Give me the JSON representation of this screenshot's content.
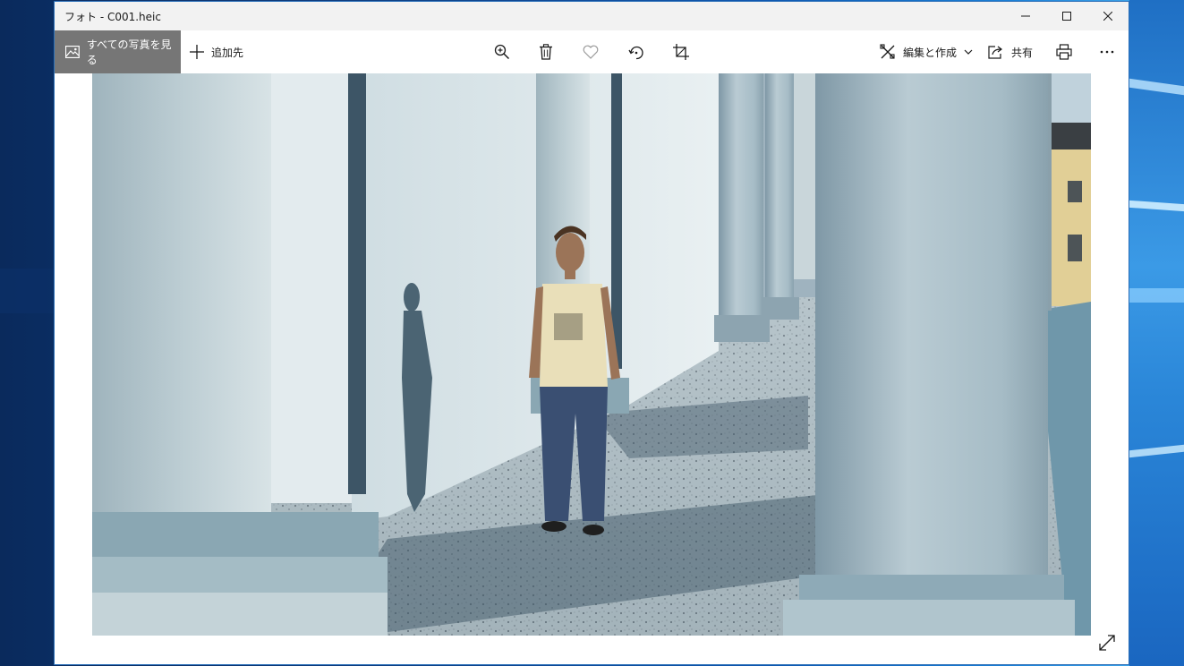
{
  "window": {
    "title": "フォト - C001.heic"
  },
  "toolbar": {
    "all_photos_label": "すべての写真を見る",
    "add_to_label": "追加先",
    "edit_create_label": "編集と作成",
    "share_label": "共有"
  },
  "icons": {
    "all_photos": "image-icon",
    "add": "plus-icon",
    "zoom": "zoom-in-icon",
    "delete": "trash-icon",
    "favorite": "heart-icon",
    "rotate": "rotate-icon",
    "crop": "crop-icon",
    "edit": "edit-create-icon",
    "share": "share-icon",
    "print": "print-icon",
    "more": "more-icon",
    "expand": "expand-icon"
  },
  "colors": {
    "active_tab_bg": "#767676",
    "titlebar_bg": "#f2f2f2",
    "desktop_accent": "#0e58b0"
  }
}
